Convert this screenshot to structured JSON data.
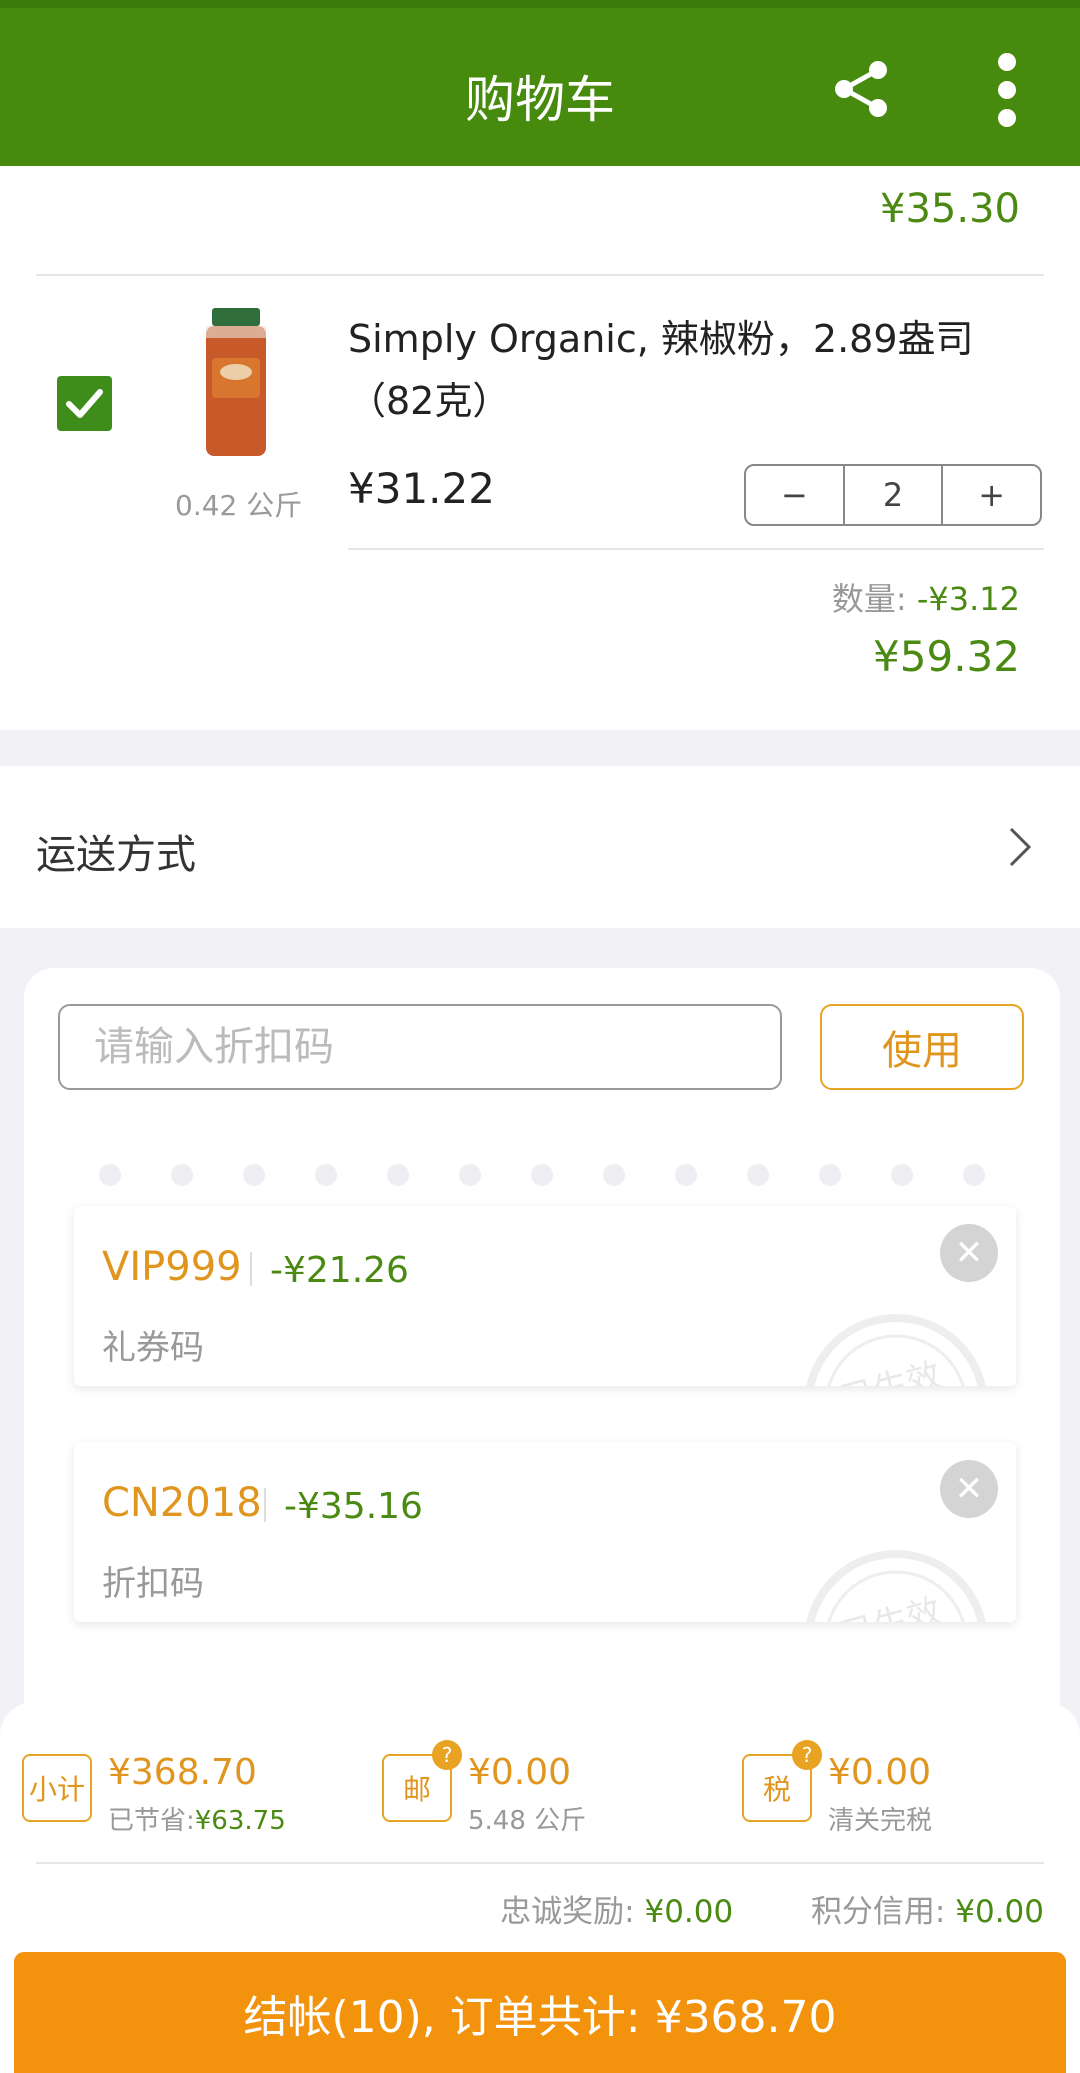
{
  "header": {
    "title": "购物车",
    "share_icon": "share-icon",
    "menu_icon": "more-vertical-icon"
  },
  "cart": {
    "prev_item_total": "¥35.30",
    "item": {
      "checked": true,
      "name": "Simply Organic, 辣椒粉，2.89盎司（82克）",
      "weight": "0.42 公斤",
      "price": "¥31.22",
      "quantity": "2",
      "minus_label": "−",
      "plus_label": "+",
      "qty_discount_label": "数量: ",
      "qty_discount_value": "-¥3.12",
      "line_total": "¥59.32"
    }
  },
  "shipping": {
    "label": "运送方式"
  },
  "discount": {
    "placeholder": "请输入折扣码",
    "use_label": "使用",
    "applied": [
      {
        "code": "VIP999",
        "amount": "-¥21.26",
        "type": "礼券码",
        "stamp": "已生效"
      },
      {
        "code": "CN2018",
        "amount": "-¥35.16",
        "type": "折扣码",
        "stamp": "已生效"
      }
    ]
  },
  "summary": {
    "subtotal_icon": "小计",
    "subtotal": "¥368.70",
    "saved_label": "已节省:",
    "saved_value": "¥63.75",
    "postage_icon": "邮",
    "postage": "¥0.00",
    "postage_weight": "5.48 公斤",
    "tax_icon": "税",
    "tax": "¥0.00",
    "tax_note": "清关完税",
    "help_mark": "?",
    "loyalty_label": "忠诚奖励: ",
    "loyalty_value": "¥0.00",
    "credit_label": "积分信用: ",
    "credit_value": "¥0.00"
  },
  "checkout": {
    "label": "结帐(10), 订单共计: ¥368.70"
  },
  "colors": {
    "header": "#468b0e",
    "accent_green": "#4b8a12",
    "accent_orange": "#e0961e",
    "checkout": "#f3920c"
  }
}
